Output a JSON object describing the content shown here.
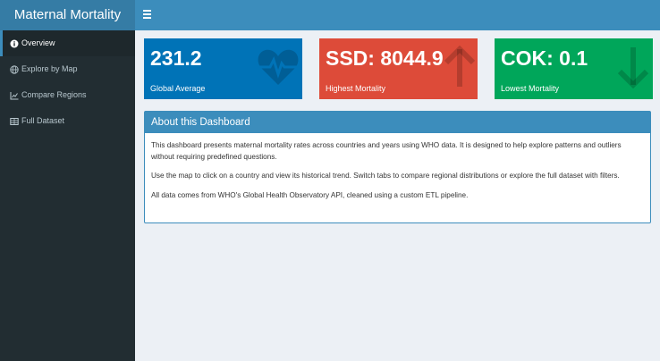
{
  "app": {
    "title": "Maternal Mortality"
  },
  "sidebar": {
    "items": [
      {
        "label": "Overview",
        "icon": "info-circle-icon",
        "active": true
      },
      {
        "label": "Explore by Map",
        "icon": "globe-icon",
        "active": false
      },
      {
        "label": "Compare Regions",
        "icon": "line-chart-icon",
        "active": false
      },
      {
        "label": "Full Dataset",
        "icon": "table-icon",
        "active": false
      }
    ]
  },
  "stats": [
    {
      "value": "231.2",
      "label": "Global Average",
      "icon": "heartbeat-icon",
      "color": "#0073b7"
    },
    {
      "value": "SSD: 8044.9",
      "label": "Highest Mortality",
      "icon": "arrow-up-icon",
      "color": "#dd4b39"
    },
    {
      "value": "COK: 0.1",
      "label": "Lowest Mortality",
      "icon": "arrow-down-icon",
      "color": "#00a65a"
    }
  ],
  "about": {
    "title": "About this Dashboard",
    "paragraphs": [
      "This dashboard presents maternal mortality rates across countries and years using WHO data. It is designed to help explore patterns and outliers without requiring predefined questions.",
      "Use the map to click on a country and view its historical trend. Switch tabs to compare regional distributions or explore the full dataset with filters.",
      "All data comes from WHO's Global Health Observatory API, cleaned using a custom ETL pipeline."
    ]
  }
}
